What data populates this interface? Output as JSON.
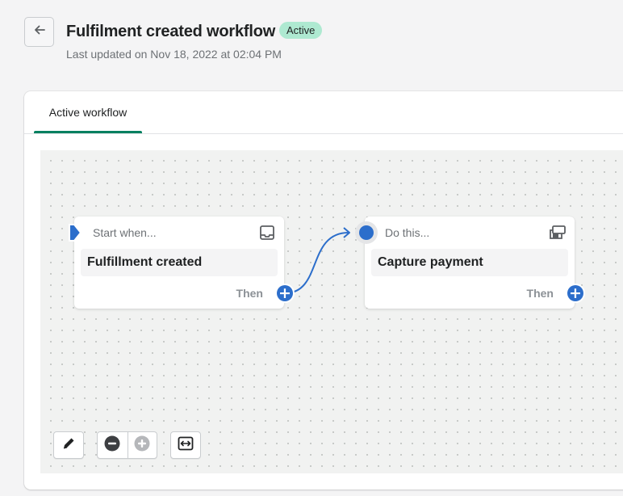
{
  "header": {
    "back_icon": "arrow-left-icon",
    "title": "Fulfilment created workflow",
    "status": "Active",
    "status_color": "#aee9d1",
    "last_updated": "Last updated on Nov 18, 2022 at 02:04 PM"
  },
  "tabs": [
    {
      "label": "Active workflow",
      "selected": true
    }
  ],
  "nodes": {
    "trigger": {
      "head": "Start when...",
      "title": "Fulfillment created",
      "then": "Then",
      "icon": "inbox-icon"
    },
    "action": {
      "head": "Do this...",
      "title": "Capture payment",
      "then": "Then",
      "icon": "card-reader-icon"
    }
  },
  "toolbar": {
    "edit_icon": "pencil-icon",
    "zoom_out_icon": "zoom-out-icon",
    "zoom_in_icon": "zoom-in-icon",
    "fit_icon": "fit-to-screen-icon"
  },
  "colors": {
    "accent": "#2c6ecb",
    "tab_indicator": "#008060"
  }
}
